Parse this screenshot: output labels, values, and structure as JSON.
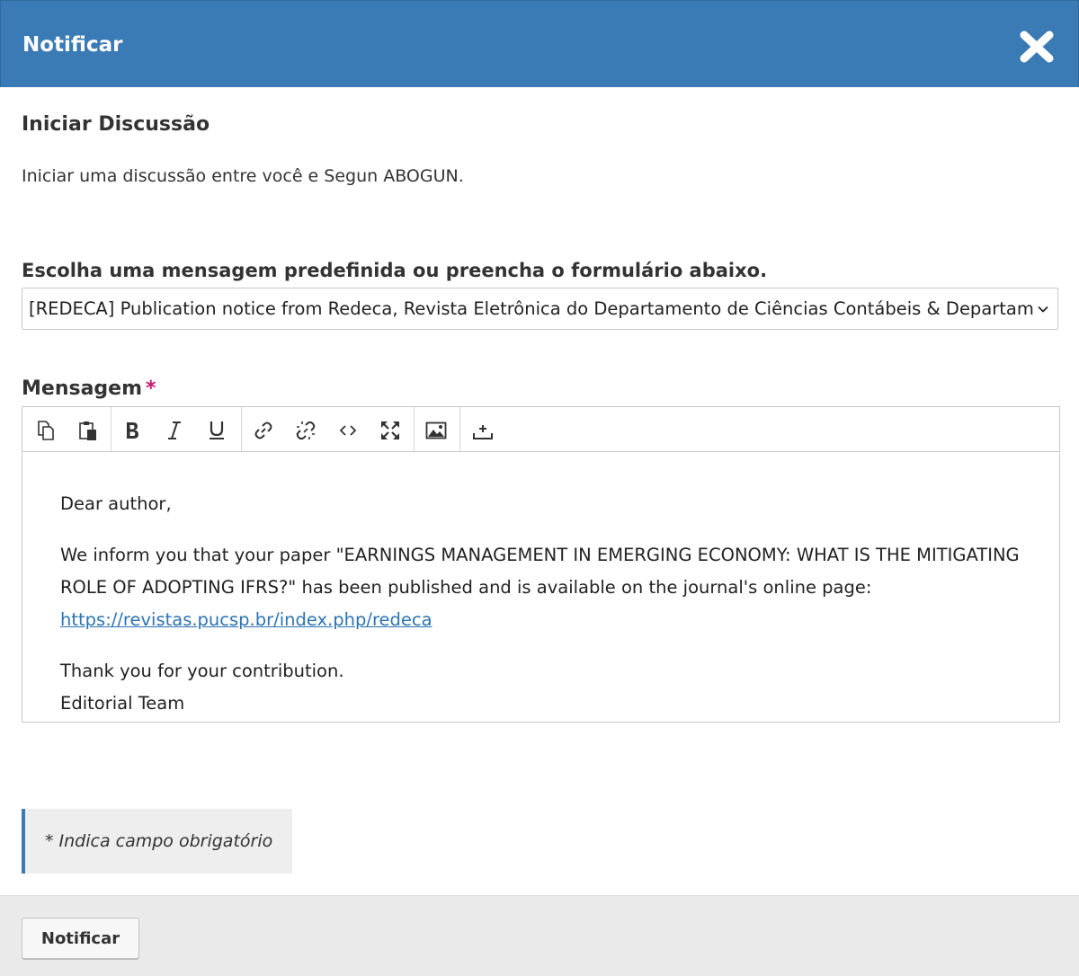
{
  "modal": {
    "title": "Notificar",
    "close_icon": "close-icon"
  },
  "discussion": {
    "title": "Iniciar Discussão",
    "description": "Iniciar uma discussão entre você e Segun ABOGUN."
  },
  "template": {
    "label": "Escolha uma mensagem predefinida ou preencha o formulário abaixo.",
    "selected": "[REDECA] Publication notice from Redeca, Revista Eletrônica do Departamento de Ciências Contábeis & Departamento"
  },
  "message": {
    "label": "Mensagem",
    "required_marker": "*",
    "toolbar": [
      "copy-icon",
      "paste-icon",
      "bold-icon",
      "italic-icon",
      "underline-icon",
      "link-icon",
      "unlink-icon",
      "code-icon",
      "fullscreen-icon",
      "image-icon",
      "upload-icon"
    ],
    "greeting": "Dear author,",
    "body": "We inform you that your paper \"EARNINGS MANAGEMENT IN EMERGING ECONOMY: WHAT IS THE MITIGATING ROLE OF ADOPTING IFRS?\" has been published and is available on the journal's online page:",
    "link": "https://revistas.pucsp.br/index.php/redeca",
    "thanks": "Thank you for your contribution.",
    "signature": "Editorial Team"
  },
  "required_note": "* Indica campo obrigatório",
  "footer": {
    "submit_label": "Notificar"
  },
  "colors": {
    "header": "#3b7bb5",
    "link": "#2c74b3",
    "required": "#c3186f"
  }
}
